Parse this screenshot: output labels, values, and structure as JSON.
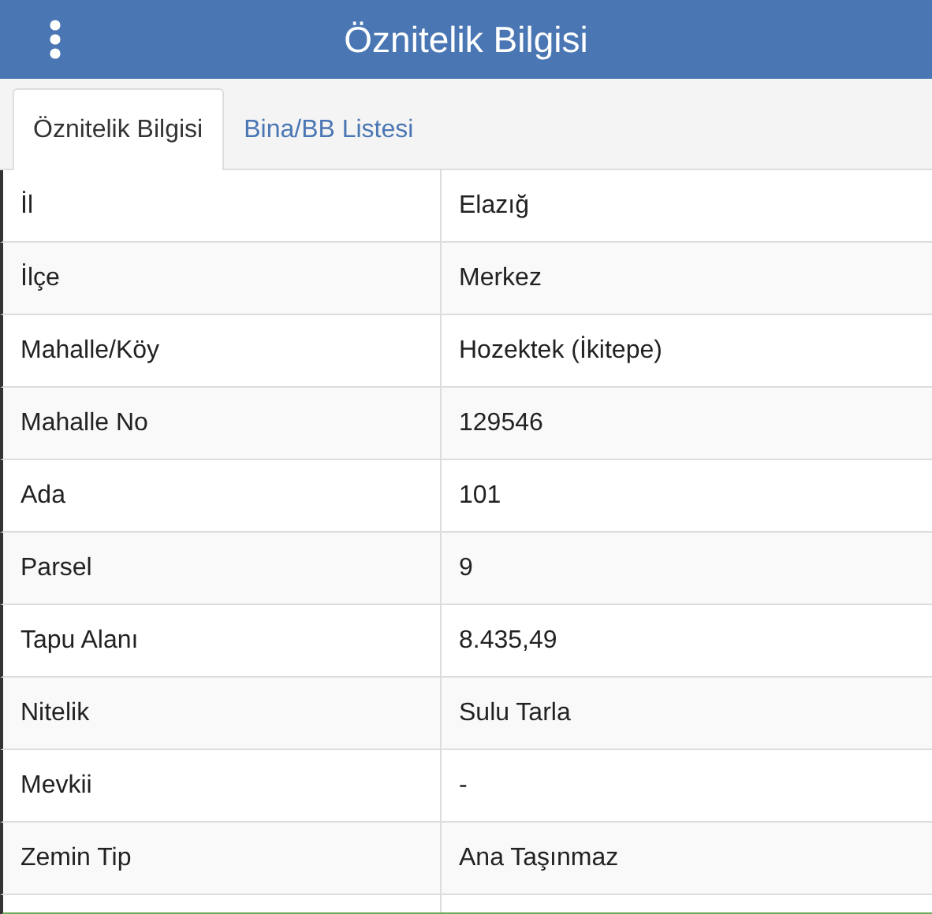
{
  "header": {
    "title": "Öznitelik Bilgisi"
  },
  "tabs": [
    {
      "label": "Öznitelik Bilgisi",
      "selected": true
    },
    {
      "label": "Bina/BB Listesi",
      "selected": false
    }
  ],
  "rows": [
    {
      "label": "İl",
      "value": "Elazığ"
    },
    {
      "label": "İlçe",
      "value": "Merkez"
    },
    {
      "label": "Mahalle/Köy",
      "value": "Hozektek (İkitepe)"
    },
    {
      "label": "Mahalle No",
      "value": "129546"
    },
    {
      "label": "Ada",
      "value": "101"
    },
    {
      "label": "Parsel",
      "value": "9"
    },
    {
      "label": "Tapu Alanı",
      "value": "8.435,49"
    },
    {
      "label": "Nitelik",
      "value": "Sulu Tarla"
    },
    {
      "label": "Mevkii",
      "value": "-"
    },
    {
      "label": "Zemin Tip",
      "value": "Ana Taşınmaz"
    }
  ]
}
